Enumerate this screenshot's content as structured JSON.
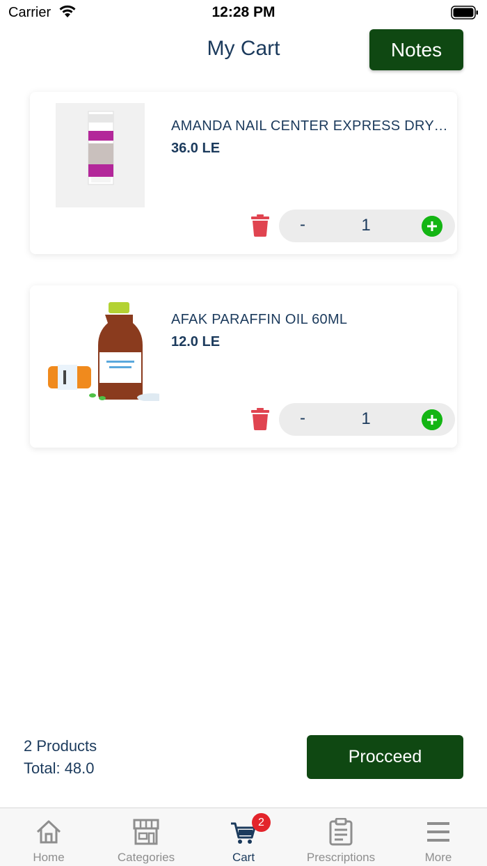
{
  "status_bar": {
    "carrier": "Carrier",
    "time": "12:28 PM"
  },
  "header": {
    "title": "My Cart",
    "notes_label": "Notes"
  },
  "cart_items": [
    {
      "name": "AMANDA  NAIL CENTER EXPRESS DRY DROPS",
      "price": "36.0 LE",
      "quantity": "1",
      "minus": "-"
    },
    {
      "name": "AFAK PARAFFIN OIL 60ML",
      "price": "12.0 LE",
      "quantity": "1",
      "minus": "-"
    }
  ],
  "summary": {
    "products_count": "2 Products",
    "total": "Total: 48.0",
    "proceed_label": "Procceed"
  },
  "tab_bar": {
    "tabs": [
      {
        "label": "Home",
        "icon": "home-icon"
      },
      {
        "label": "Categories",
        "icon": "store-icon"
      },
      {
        "label": "Cart",
        "icon": "cart-icon",
        "active": true,
        "badge": "2"
      },
      {
        "label": "Prescriptions",
        "icon": "clipboard-icon"
      },
      {
        "label": "More",
        "icon": "menu-icon"
      }
    ]
  },
  "colors": {
    "primary_green": "#0f4812",
    "text_navy": "#1b3a5c",
    "plus_green": "#14b514",
    "trash_red": "#e04450",
    "badge_red": "#e3242b"
  }
}
